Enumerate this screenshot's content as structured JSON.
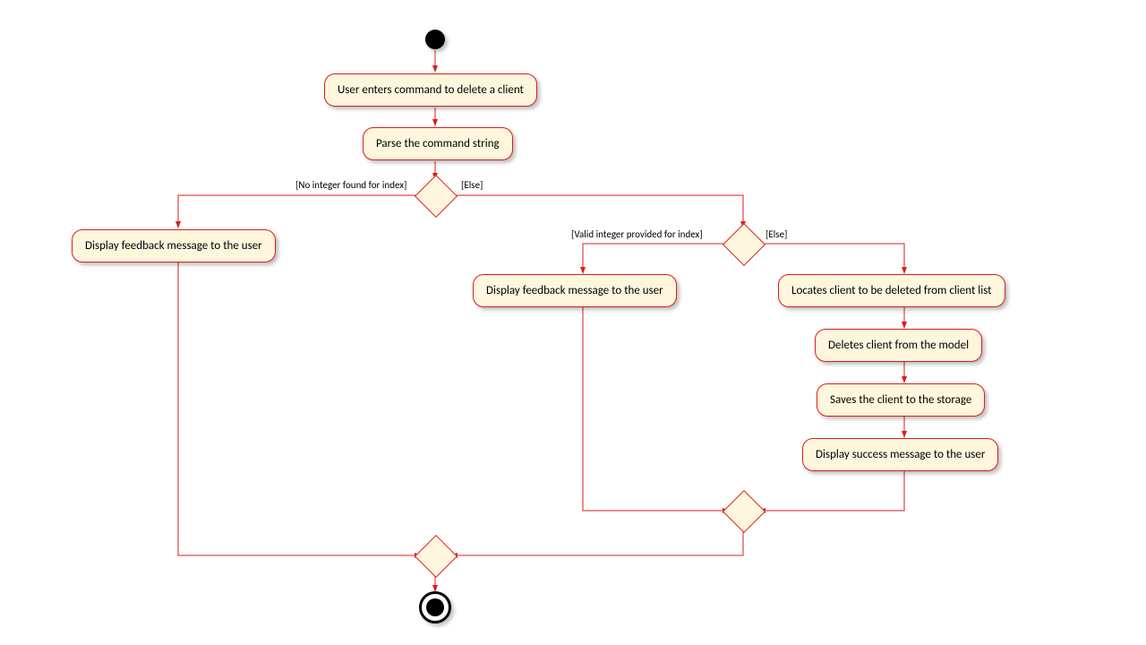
{
  "diagram_type": "UML Activity Diagram",
  "nodes": {
    "a1": "User enters command to delete a client",
    "a2": "Parse the command string",
    "a3": "Display feedback message to the user",
    "a4": "Display feedback message to the user",
    "a5": "Locates client to be deleted from client list",
    "a6": "Deletes client from the model",
    "a7": "Saves the client to the storage",
    "a8": "Display success message to the user"
  },
  "guards": {
    "g1": "[No integer found for index]",
    "g2": "[Else]",
    "g3": "[Valid integer provided for index]",
    "g4": "[Else]"
  },
  "colors": {
    "edge": "#dc1d1d",
    "fill": "#fef7dd"
  }
}
